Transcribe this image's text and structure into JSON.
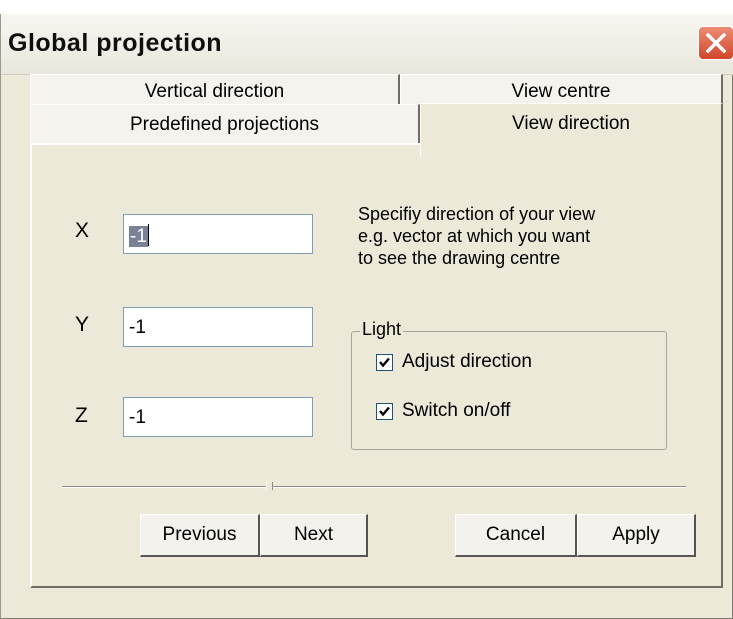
{
  "window": {
    "title": "Global projection"
  },
  "tabs": {
    "row1": [
      {
        "label": "Vertical direction"
      },
      {
        "label": "View centre"
      }
    ],
    "row2": [
      {
        "label": "Predefined projections"
      },
      {
        "label": "View direction",
        "active": true
      }
    ]
  },
  "fields": {
    "x": {
      "label": "X",
      "value": "-1"
    },
    "y": {
      "label": "Y",
      "value": "-1"
    },
    "z": {
      "label": "Z",
      "value": "-1"
    }
  },
  "help_text": [
    "Specifiy direction of your view",
    "e.g. vector at which you want",
    "to see the drawing centre"
  ],
  "light": {
    "legend": "Light",
    "adjust_direction": {
      "label": "Adjust direction",
      "checked": true
    },
    "switch_on_off": {
      "label": "Switch on/off",
      "checked": true
    }
  },
  "buttons": {
    "previous": "Previous",
    "next": "Next",
    "cancel": "Cancel",
    "apply": "Apply"
  },
  "colors": {
    "close_button": "#d0462a",
    "dialog_background": "#ece9d8"
  },
  "icons": {
    "close": "close-icon",
    "check": "check-icon"
  }
}
